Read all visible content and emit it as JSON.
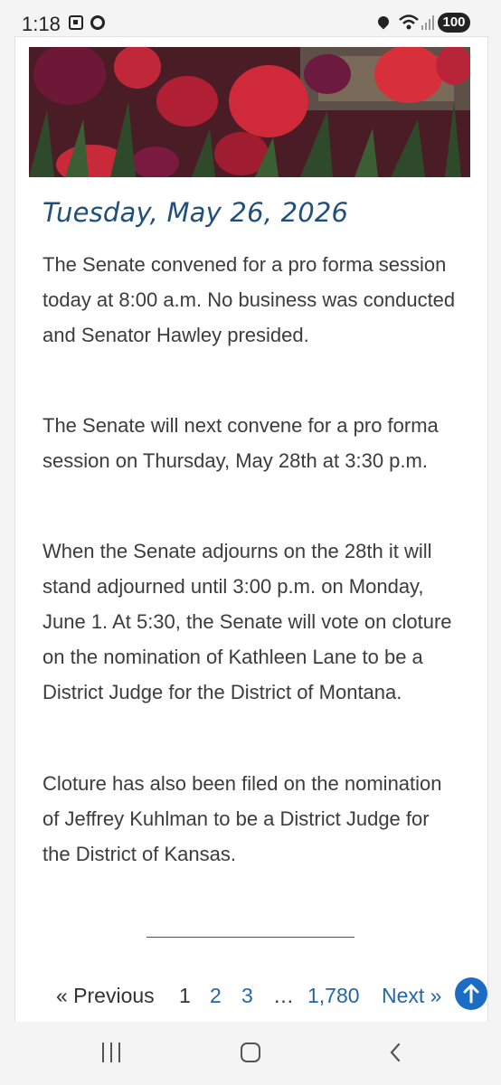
{
  "status_bar": {
    "time": "1:18",
    "battery": "100"
  },
  "post": {
    "date": "Tuesday, May 26, 2026",
    "paragraphs": [
      "The Senate convened for a pro forma session today at 8:00 a.m. No business was conducted and Senator Hawley presided.",
      "The Senate will next convene for a pro forma session on Thursday, May 28th at 3:30 p.m.",
      "When the Senate adjourns on the 28th it will stand adjourned until 3:00 p.m. on Monday, June 1. At 5:30, the Senate will vote on cloture on the nomination of Kathleen Lane to be a District Judge for the District of Montana.",
      "Cloture has also been filed on the nomination of Jeffrey Kuhlman to be a District Judge for the District of Kansas."
    ]
  },
  "pagination": {
    "previous": "« Previous",
    "current": "1",
    "page2": "2",
    "page3": "3",
    "ellipsis": "…",
    "last": "1,780",
    "next": "Next »"
  },
  "colors": {
    "date": "#1f4f7a",
    "link": "#2466a8",
    "scroll_top_button": "#1a6cc4"
  },
  "icons": {
    "scroll_top": "arrow-up-icon",
    "nav_recents": "recents-icon",
    "nav_home": "home-icon",
    "nav_back": "back-icon"
  }
}
